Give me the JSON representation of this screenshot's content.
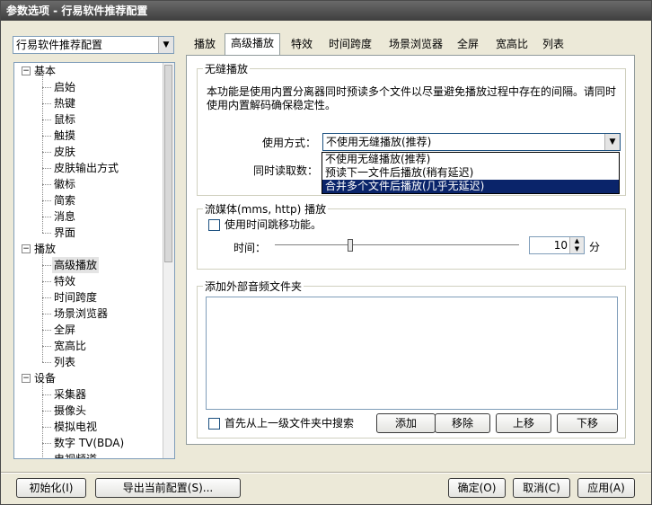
{
  "window": {
    "title": "参数选项 - 行易软件推荐配置"
  },
  "profile": {
    "selected": "行易软件推荐配置"
  },
  "tree": {
    "groups": [
      {
        "label": "基本",
        "children": [
          "启始",
          "热键",
          "鼠标",
          "触摸",
          "皮肤",
          "皮肤输出方式",
          "徽标",
          "简索",
          "消息",
          "界面"
        ]
      },
      {
        "label": "播放",
        "children": [
          "高级播放",
          "特效",
          "时间跨度",
          "场景浏览器",
          "全屏",
          "宽高比",
          "列表"
        ]
      },
      {
        "label": "设备",
        "children": [
          "采集器",
          "摄像头",
          "模拟电视",
          "数字 TV(BDA)",
          "电视频道"
        ]
      }
    ],
    "selected": "高级播放"
  },
  "tabs": [
    "播放",
    "高级播放",
    "特效",
    "时间跨度",
    "场景浏览器",
    "全屏",
    "宽高比",
    "列表"
  ],
  "active_tab": "高级播放",
  "seamless": {
    "legend": "无缝播放",
    "description_line1": "本功能是使用内置分离器同时预读多个文件以尽量避免播放过程中存在的间隔。请同时",
    "description_line2": "使用内置解码确保稳定性。",
    "mode_label": "使用方式：",
    "mode_value": "不使用无缝播放(推荐)",
    "concurrent_label": "同时读取数：",
    "options": [
      "不使用无缝播放(推荐)",
      "预读下一文件后播放(稍有延迟)",
      "合并多个文件后播放(几乎无延迟)"
    ],
    "highlighted_option": 2
  },
  "streaming": {
    "legend": "流媒体(mms, http) 播放",
    "checkbox_label": "使用时间跳移功能。",
    "time_label": "时间：",
    "time_value": "10",
    "time_unit": "分",
    "slider_fraction": 0.31
  },
  "audio_folder": {
    "legend": "添加外部音频文件夹",
    "search_parent_label": "首先从上一级文件夹中搜索",
    "add_label": "添加",
    "remove_label": "移除",
    "up_label": "上移",
    "down_label": "下移"
  },
  "footer": {
    "init_label": "初始化(I)",
    "export_label": "导出当前配置(S)...",
    "ok_label": "确定(O)",
    "cancel_label": "取消(C)",
    "apply_label": "应用(A)"
  },
  "colors": {
    "title_bar": "#4a4a4a",
    "dialog_bg": "#ece9d8",
    "selection": "#0a246a"
  }
}
